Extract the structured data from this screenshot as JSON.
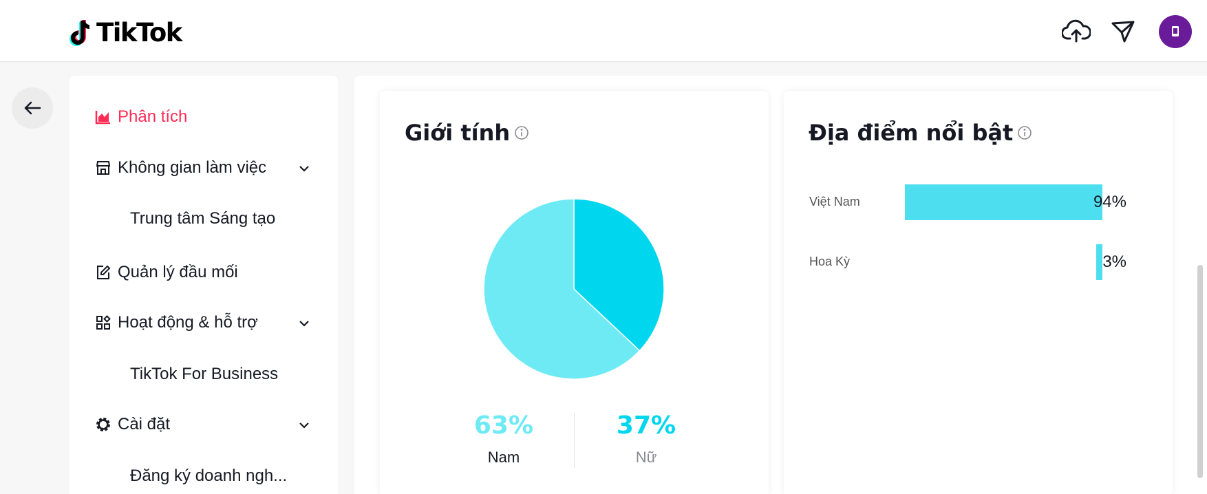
{
  "header": {
    "logo_text": "TikTok",
    "icons": [
      "upload-cloud-icon",
      "inbox-send-icon"
    ],
    "avatar": "profile-avatar"
  },
  "sidebar": {
    "items": [
      {
        "label": "Phân tích",
        "icon": "chart-icon",
        "active": true
      },
      {
        "label": "Không gian làm việc",
        "icon": "storefront-icon",
        "expandable": true
      },
      {
        "label": "Trung tâm Sáng tạo",
        "sub": true
      },
      {
        "label": "Quản lý đầu mối",
        "icon": "edit-icon"
      },
      {
        "label": "Hoạt động & hỗ trợ",
        "icon": "apps-icon",
        "expandable": true
      },
      {
        "label": "TikTok For Business",
        "sub": true
      },
      {
        "label": "Cài đặt",
        "icon": "gear-icon",
        "expandable": true
      },
      {
        "label": "Đăng ký doanh ngh...",
        "sub": true
      }
    ]
  },
  "gender_card": {
    "title": "Giới tính",
    "male_pct": "63%",
    "male_label": "Nam",
    "female_pct": "37%",
    "female_label": "Nữ"
  },
  "location_card": {
    "title": "Địa điểm nổi bật"
  },
  "colors": {
    "accent": "#fe2c55",
    "male": "#6eeaf5",
    "female": "#00d7ee",
    "bar": "#4ddfef"
  },
  "chart_data": [
    {
      "type": "pie",
      "title": "Giới tính",
      "categories": [
        "Nam",
        "Nữ"
      ],
      "values": [
        63,
        37
      ]
    },
    {
      "type": "bar",
      "title": "Địa điểm nổi bật",
      "categories": [
        "Việt Nam",
        "Hoa Kỳ"
      ],
      "values": [
        94,
        3
      ],
      "value_labels": [
        "94%",
        "3%"
      ],
      "ylim": [
        0,
        100
      ]
    }
  ]
}
